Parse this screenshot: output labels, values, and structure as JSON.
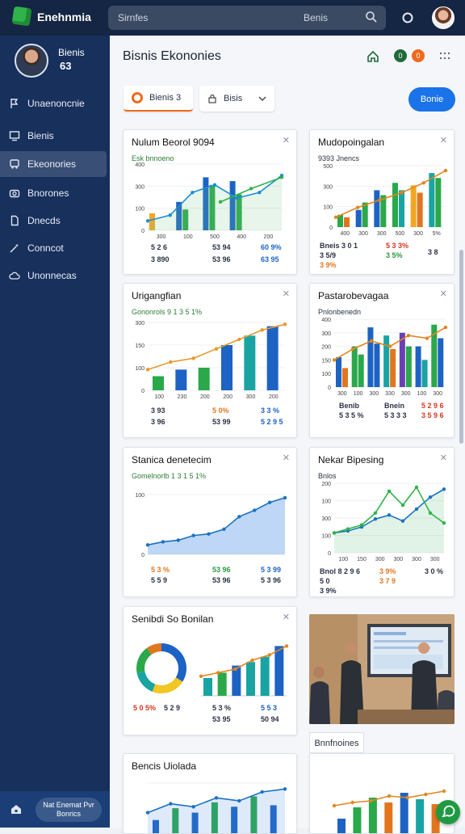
{
  "app": {
    "title": "Enehnmia"
  },
  "search": {
    "placeholder": "Sirnfes",
    "hint": "Benis"
  },
  "sidebar": {
    "user_name": "Bienis",
    "user_sub": "63",
    "items": [
      {
        "label": "Unaenoncnie",
        "icon": "flag-icon"
      },
      {
        "label": "Bienis",
        "icon": "monitor-icon"
      },
      {
        "label": "Ekeonories",
        "icon": "bus-icon"
      },
      {
        "label": "Bnorones",
        "icon": "camera-icon"
      },
      {
        "label": "Dnecds",
        "icon": "document-icon"
      },
      {
        "label": "Conncot",
        "icon": "magic-wand-icon"
      },
      {
        "label": "Unonnecas",
        "icon": "cloud-icon"
      }
    ],
    "bottom_pill": "Nat Enemat Pvr Bonrics"
  },
  "header": {
    "title": "Bisnis Ekononies",
    "badge_green": "0",
    "badge_orange": "0"
  },
  "filters": {
    "first": "Bienis 3",
    "second": "Bisis",
    "primary": "Bonie"
  },
  "cards": [
    {
      "title": "Nulum Beorol 9094",
      "sub": "Esk bnnoeno",
      "stats": [
        "5 2 6",
        "53 94",
        "60 9%",
        "3 890",
        "53 96",
        "63 95"
      ]
    },
    {
      "title": "Mudopoingalan",
      "sub": "9393 Jnencs",
      "stats": [
        "Bneis 3 0 1",
        "5 3 3%",
        "3 8",
        "3 5/9",
        "3 5%",
        "3 9%"
      ]
    },
    {
      "title": "Urigangfian",
      "sub": "Gononrols 9 1 3 5 1%",
      "stats": [
        "3 93",
        "5 0%",
        "3 3 %",
        "3 96",
        "53 99",
        "5 2 9 5"
      ]
    },
    {
      "title": "Pastarobevagaa",
      "sub": "Pnlonbenedn",
      "stats": [
        "Benib",
        "Bnein",
        "5 2 9 6",
        "5 3 5 %",
        "5 3 3 3",
        "3 5 9 6"
      ]
    },
    {
      "title": "Stanica denetecim",
      "sub": "Gomelnorlb 1 3 1 5 1%",
      "stats": [
        "5 3 %",
        "53 96",
        "5 3 99",
        "5 5 9",
        "53 96",
        "5 3 96"
      ]
    },
    {
      "title": "Nekar Bipesing",
      "sub": "Bnlos",
      "stats": [
        "Bnol 8 2 9 6",
        "3 9%",
        "3 0 %",
        "5 0",
        "3 7 9",
        "3 9%"
      ]
    },
    {
      "title": "Senibdi So Bonilan",
      "sub": "",
      "stats": [
        "5 0 5%",
        "5 2 9",
        "5 3 %",
        "5 5 3",
        "53 95",
        "50 94"
      ]
    },
    {
      "title": "Bencis Uiolada",
      "sub": "",
      "stats": []
    },
    {
      "title": "Bnnfnoines",
      "sub": "",
      "stats": []
    }
  ],
  "chart_data": [
    {
      "type": "bar",
      "title": "Nulum Beorol 9094",
      "y_ticks": [
        "400",
        "300",
        "100",
        "0"
      ],
      "x_ticks": [
        "300",
        "100",
        "500",
        "400",
        "200"
      ],
      "series": [
        {
          "values": [
            18,
            30,
            56,
            52,
            0
          ]
        },
        {
          "values": [
            0,
            22,
            48,
            38,
            0
          ]
        }
      ]
    },
    {
      "type": "bar",
      "title": "Mudopoingalan",
      "y_ticks": [
        "500",
        "300",
        "100",
        "0"
      ],
      "x_ticks": [
        "400",
        "300",
        "300",
        "500",
        "300",
        "5%"
      ],
      "series": [
        {
          "values": [
            10,
            14,
            30,
            36,
            34,
            44
          ]
        },
        {
          "values": [
            8,
            20,
            26,
            30,
            28,
            40
          ]
        }
      ]
    },
    {
      "type": "bar",
      "title": "Urigangfian",
      "y_ticks": [
        "300",
        "150",
        "100",
        "0"
      ],
      "x_ticks": [
        "100",
        "230",
        "200",
        "200",
        "300",
        "200"
      ],
      "values": [
        15,
        22,
        24,
        48,
        58,
        68
      ]
    },
    {
      "type": "bar",
      "title": "Pastarobevagaa",
      "y_ticks": [
        "400",
        "300",
        "200",
        "150",
        "100",
        "0"
      ],
      "x_ticks": [
        "300",
        "100",
        "300",
        "330",
        "300",
        "100",
        "300"
      ],
      "values": [
        22,
        30,
        44,
        38,
        40,
        30,
        46
      ]
    },
    {
      "type": "area",
      "title": "Stanica denetecim",
      "y_ticks": [
        "100",
        "0"
      ],
      "values": [
        12,
        16,
        18,
        24,
        26,
        32,
        48,
        56,
        66,
        72
      ]
    },
    {
      "type": "line",
      "title": "Nekar Bipesing",
      "y_ticks": [
        "200",
        "100",
        "300",
        "100",
        "0"
      ],
      "x_ticks": [
        "100",
        "150",
        "300",
        "300",
        "300",
        "300"
      ],
      "series": [
        {
          "values": [
            20,
            22,
            26,
            34,
            38,
            32,
            44,
            56,
            64
          ]
        },
        {
          "values": [
            20,
            24,
            28,
            40,
            62,
            48,
            66,
            40,
            30
          ]
        }
      ]
    },
    {
      "type": "pie",
      "title": "Senibdi So Bonilan",
      "values": [
        34,
        22,
        16,
        18,
        10
      ]
    },
    {
      "type": "bar",
      "title": "Senibdi So Bonilan",
      "values": [
        20,
        26,
        34,
        38,
        44,
        56
      ]
    }
  ]
}
